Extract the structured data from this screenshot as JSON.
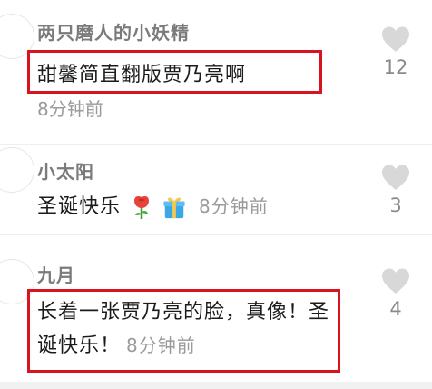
{
  "comments": [
    {
      "username": "两只磨人的小妖精",
      "text": "甜馨简直翻版贾乃亮啊",
      "time": "8分钟前",
      "likes": "12",
      "highlighted": true
    },
    {
      "username": "小太阳",
      "text": "圣诞快乐",
      "emojis": [
        "rose-emoji",
        "gift-emoji"
      ],
      "time": "8分钟前",
      "likes": "3",
      "highlighted": false
    },
    {
      "username": "九月",
      "text": "长着一张贾乃亮的脸，真像！圣诞快乐！",
      "time": "8分钟前",
      "likes": "4",
      "highlighted": true
    }
  ],
  "colors": {
    "highlight_border": "#d9141f",
    "username": "#7b7b7b",
    "meta": "#9a9a9a",
    "like_icon": "#d8d8d8"
  },
  "icons": {
    "like": "heart-icon"
  }
}
